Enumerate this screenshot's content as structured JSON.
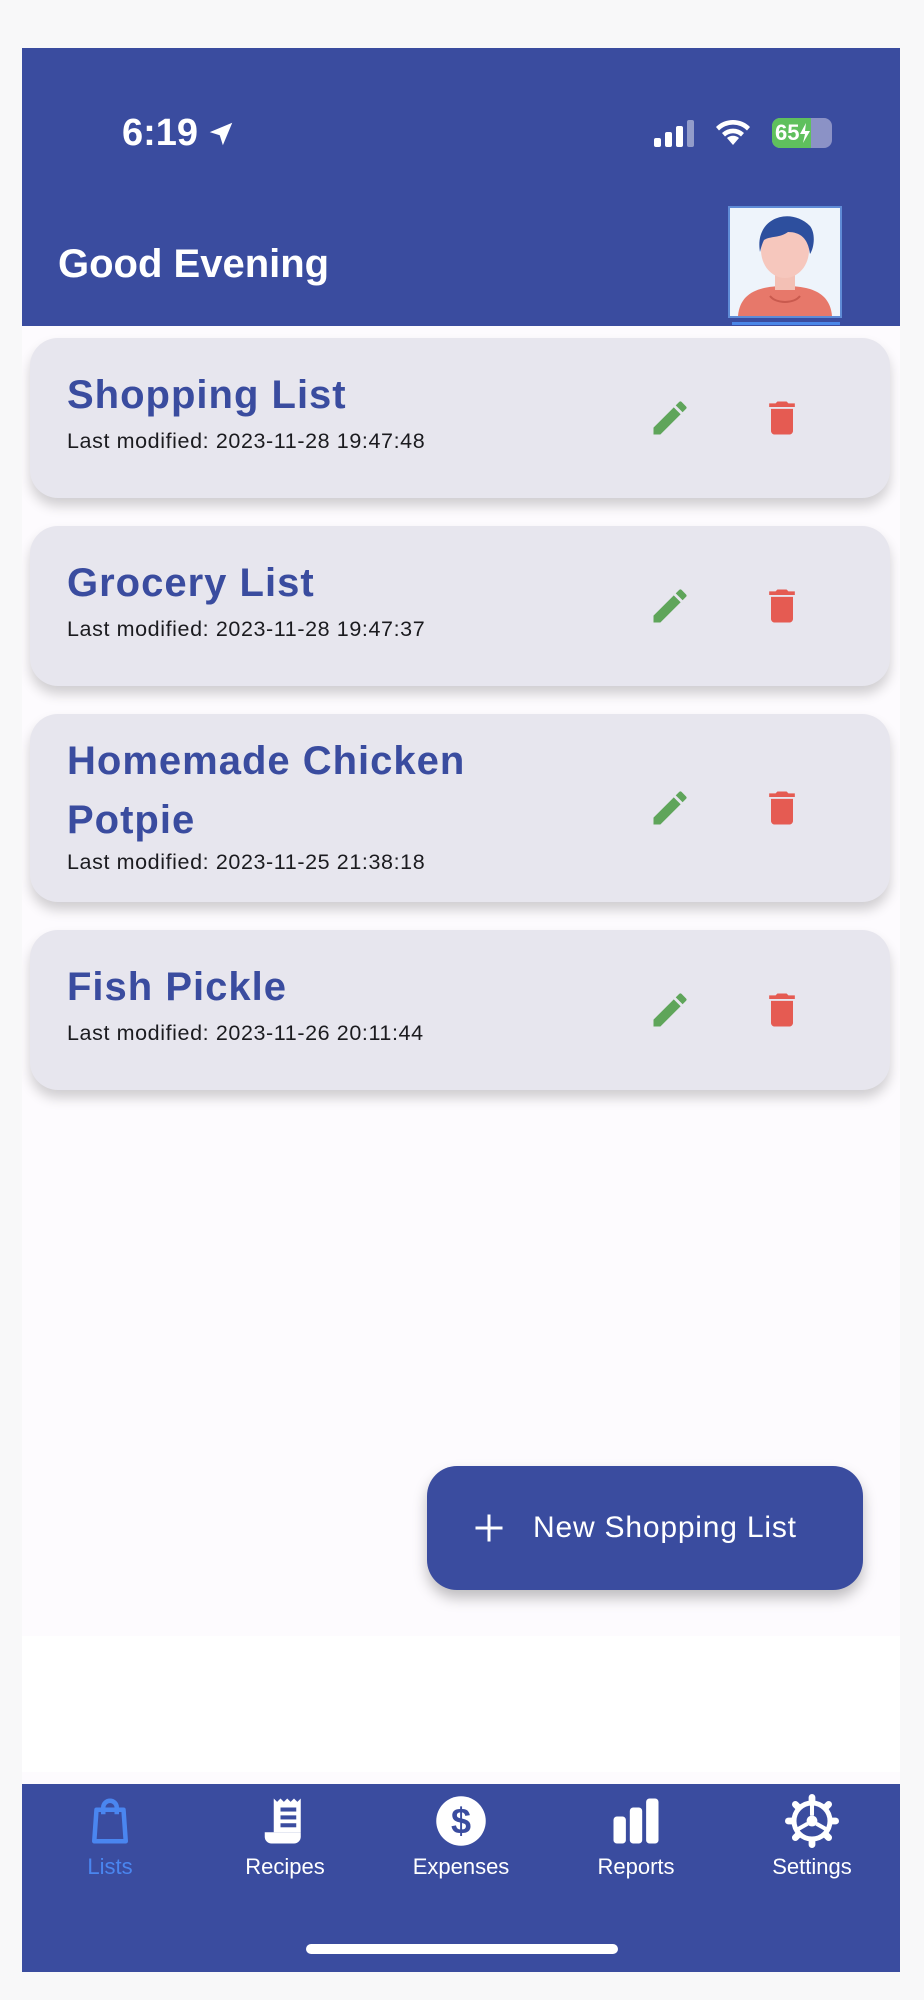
{
  "status_bar": {
    "time": "6:19",
    "battery": "65",
    "battery_level": 0.65
  },
  "header": {
    "greeting": "Good Evening"
  },
  "lists": [
    {
      "title": "Shopping List",
      "modified": "Last modified: 2023-11-28 19:47:48"
    },
    {
      "title": "Grocery List",
      "modified": "Last modified: 2023-11-28 19:47:37"
    },
    {
      "title": "Homemade Chicken Potpie",
      "modified": "Last modified: 2023-11-25 21:38:18"
    },
    {
      "title": "Fish Pickle",
      "modified": "Last modified: 2023-11-26 20:11:44"
    }
  ],
  "fab": {
    "label": "New Shopping List"
  },
  "nav": [
    {
      "label": "Lists",
      "icon": "shopping-bag-icon",
      "active": true
    },
    {
      "label": "Recipes",
      "icon": "receipt-icon",
      "active": false
    },
    {
      "label": "Expenses",
      "icon": "dollar-icon",
      "active": false
    },
    {
      "label": "Reports",
      "icon": "bar-chart-icon",
      "active": false
    },
    {
      "label": "Settings",
      "icon": "gear-icon",
      "active": false
    }
  ],
  "colors": {
    "primary": "#3a4c9f",
    "edit": "#5fa55a",
    "delete": "#e55b52",
    "active_nav": "#4a86f0",
    "card": "#e7e6ee"
  }
}
